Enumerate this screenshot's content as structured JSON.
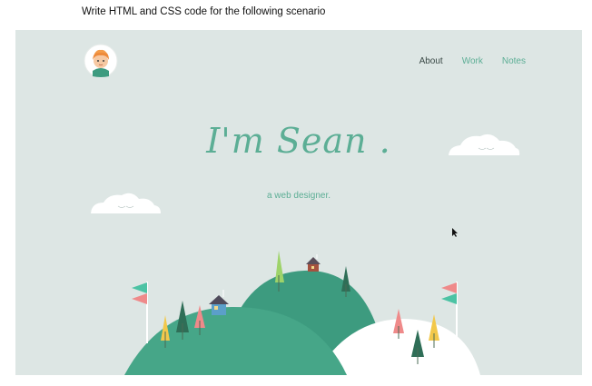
{
  "instruction": "Write HTML and CSS code for the following scenario",
  "nav": {
    "about": "About",
    "work": "Work",
    "notes": "Notes"
  },
  "hero": {
    "title": "I'm Sean .",
    "subtitle": "a web designer."
  },
  "colors": {
    "background": "#dde6e4",
    "accent": "#5cae95",
    "hill_dark": "#3d9b7f",
    "hill_front": "#46a688",
    "snow": "#ffffff",
    "flag_teal": "#4cc3a4",
    "flag_pink": "#ef8a8a"
  },
  "icons": {
    "avatar": "avatar-icon",
    "cloud": "cloud-icon",
    "tree": "tree-icon",
    "house": "house-icon",
    "flag": "flag-icon",
    "cursor": "cursor-icon"
  }
}
